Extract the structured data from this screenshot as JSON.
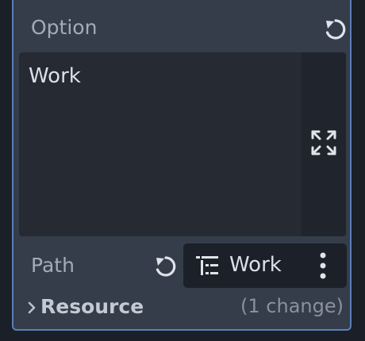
{
  "inspector": {
    "option": {
      "label": "Option",
      "value": "Work",
      "revert_icon": "revert-icon",
      "expand_icon": "expand-icon"
    },
    "path": {
      "label": "Path",
      "revert_icon": "revert-icon",
      "node_icon": "node-tree-icon",
      "node_name": "Work",
      "menu_icon": "kebab-menu-icon"
    },
    "resource": {
      "chevron_icon": "chevron-right-icon",
      "label": "Resource",
      "changes": "(1 change)"
    }
  },
  "colors": {
    "panel": "#353d4a",
    "border": "#5b7fb7",
    "editor_bg": "#262a33",
    "text": "#dbe0e8",
    "muted": "#a4abb8"
  }
}
